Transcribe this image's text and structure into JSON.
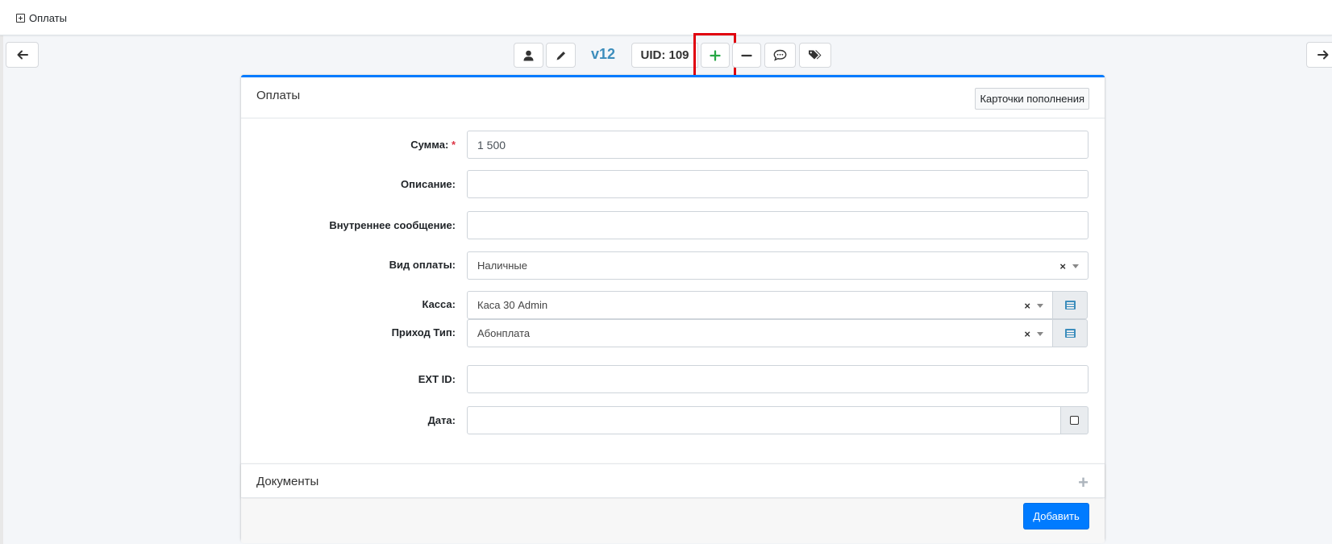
{
  "topbar": {
    "title": "Оплаты"
  },
  "toolbar": {
    "version": "v12",
    "uid": "UID: 109",
    "accent_color": "#3c8dbc",
    "add_button_color": "#28a745",
    "highlight_color": "#e0000f"
  },
  "card": {
    "title": "Оплаты",
    "cards_button": "Карточки пополнения",
    "fields": {
      "amount": {
        "label": "Сумма:",
        "required_mark": "*",
        "value": "1 500"
      },
      "description": {
        "label": "Описание:",
        "value": ""
      },
      "internal_message": {
        "label": "Внутреннее сообщение:",
        "value": ""
      },
      "payment_type": {
        "label": "Вид оплаты:",
        "value": "Наличные",
        "clear": "×"
      },
      "cashbox": {
        "label": "Касса:",
        "value": "Каса 30 Admin",
        "clear": "×"
      },
      "income_type": {
        "label": "Приход Тип:",
        "value": "Абонплата",
        "clear": "×"
      },
      "ext_id": {
        "label": "EXT ID:",
        "value": ""
      },
      "date": {
        "label": "Дата:",
        "value": ""
      }
    },
    "documents_title": "Документы",
    "documents_expand": "+",
    "submit_label": "Добавить"
  }
}
